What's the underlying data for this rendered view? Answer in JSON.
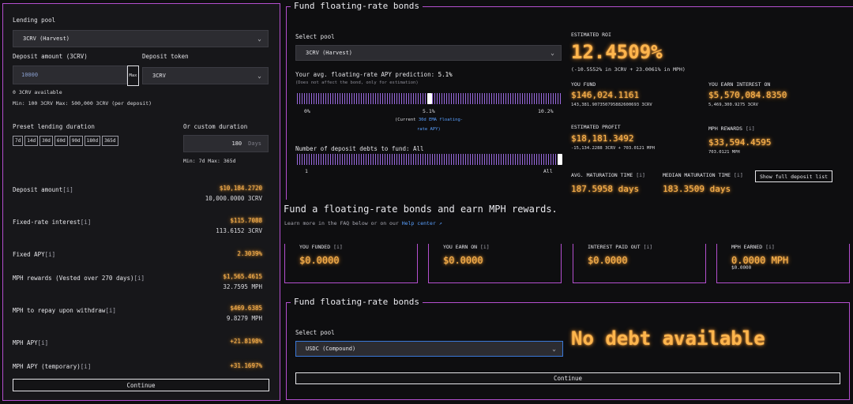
{
  "left": {
    "lending_pool_label": "Lending pool",
    "lending_pool_value": "3CRV (Harvest)",
    "deposit_amount_label": "Deposit amount (3CRV)",
    "deposit_amount_value": "10000",
    "max_label": "Max",
    "deposit_token_label": "Deposit token",
    "deposit_token_value": "3CRV",
    "available": "0 3CRV available",
    "min_max": "Min: 100 3CRV Max: 500,000 3CRV (per deposit)",
    "preset_label": "Preset lending duration",
    "presets": [
      "7d",
      "14d",
      "30d",
      "60d",
      "90d",
      "180d",
      "365d"
    ],
    "custom_label": "Or custom duration",
    "custom_value": "180",
    "custom_unit": "Days",
    "custom_minmax": "Min: 7d Max: 365d",
    "rows": [
      {
        "label": "Deposit amount",
        "info": "[i]",
        "value": "$10,184.2720",
        "sub": "10,000.0000 3CRV"
      },
      {
        "label": "Fixed-rate interest",
        "info": "[i]",
        "value": "$115.7088",
        "sub": "113.6152 3CRV"
      },
      {
        "label": "Fixed APY",
        "info": "[i]",
        "value": "2.3039%",
        "sub": ""
      },
      {
        "label": "MPH rewards (Vested over 270 days)",
        "info": "[i]",
        "value": "$1,565.4615",
        "sub": "32.7595 MPH"
      },
      {
        "label": "MPH to repay upon withdraw",
        "info": "[i]",
        "value": "$469.6385",
        "sub": "9.8279 MPH"
      },
      {
        "label": "MPH APY",
        "info": "[i]",
        "value": "+21.8198%",
        "sub": ""
      },
      {
        "label": "MPH APY (temporary)",
        "info": "[i]",
        "value": "+31.1697%",
        "sub": ""
      }
    ],
    "continue_label": "Continue"
  },
  "fund_top": {
    "title": "Fund floating-rate bonds",
    "select_pool_label": "Select pool",
    "select_pool_value": "3CRV (Harvest)",
    "apy_prediction_label": "Your avg. floating-rate APY prediction:",
    "apy_prediction_value": "5.1%",
    "apy_note": "(Does not affect the bond, only for estimation)",
    "slider1_min": "0%",
    "slider1_mid": "5.1%",
    "slider1_max": "10.2%",
    "slider1_fraction": 0.5,
    "current_note_a": "(Current",
    "current_note_link": "30d EMA floating-",
    "current_note_b": "rate APY)",
    "debts_label": "Number of deposit debts to fund: All",
    "slider2_min": "1",
    "slider2_max": "All",
    "slider2_fraction": 1.0,
    "est_roi_label": "ESTIMATED ROI",
    "est_roi_value": "12.4509%",
    "est_roi_sub": "(-10.5552% in 3CRV + 23.0061% in MPH)",
    "you_fund_label": "YOU FUND",
    "you_fund_value": "$146,024.1161",
    "you_fund_sub": "143,381.907350795882600693 3CRV",
    "earn_interest_label": "YOU EARN INTEREST ON",
    "earn_interest_value": "$5,570,084.8350",
    "earn_interest_sub": "5,469,300.9275 3CRV",
    "est_profit_label": "ESTIMATED PROFIT",
    "est_profit_value": "$18,181.3492",
    "est_profit_sub": "-15,134.2288 3CRV + 703.0121 MPH",
    "mph_rewards_label": "MPH REWARDS",
    "mph_rewards_info": "[i]",
    "mph_rewards_value": "$33,594.4595",
    "mph_rewards_sub": "703.0121 MPH",
    "avg_mat_label": "AVG. MATURATION TIME",
    "avg_mat_info": "[i]",
    "avg_mat_value": "187.5958 days",
    "med_mat_label": "MEDIAN MATURATION TIME",
    "med_mat_info": "[i]",
    "med_mat_value": "183.3509 days",
    "show_full_label": "Show full deposit list"
  },
  "earn": {
    "heading": "Fund a floating-rate bonds and earn MPH rewards.",
    "learn_prefix": "Learn more in the FAQ below or on our",
    "learn_link": "Help center",
    "ext_icon": "↗",
    "cards": [
      {
        "title": "YOU FUNDED",
        "info": "[i]",
        "value": "$0.0000",
        "sub": ""
      },
      {
        "title": "YOU EARN ON",
        "info": "[i]",
        "value": "$0.0000",
        "sub": ""
      },
      {
        "title": "INTEREST PAID OUT",
        "info": "[i]",
        "value": "$0.0000",
        "sub": ""
      },
      {
        "title": "MPH EARNED",
        "info": "[i]",
        "value": "0.0000 MPH",
        "sub": "$0.0000"
      }
    ]
  },
  "fund_bottom": {
    "title": "Fund floating-rate bonds",
    "select_pool_label": "Select pool",
    "select_pool_value": "USDC (Compound)",
    "no_debt": "No debt available",
    "continue_label": "Continue"
  },
  "colors": {
    "accent": "#b44fcf",
    "glow": "#ffb54d",
    "slider": "#9b6ae0",
    "link": "#5aa0ff"
  }
}
